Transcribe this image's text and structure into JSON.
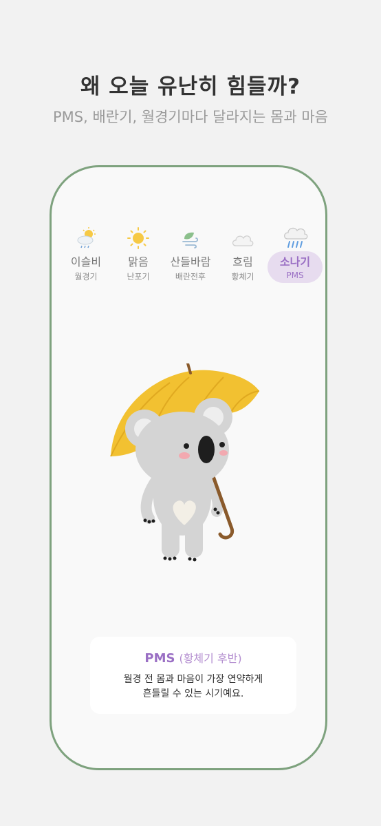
{
  "header": {
    "headline": "왜 오늘 유난히 힘들까?",
    "subheadline": "PMS, 배란기, 월경기마다 달라지는 몸과 마음"
  },
  "weather_tabs": [
    {
      "icon": "sun-rain-cloud-icon",
      "label": "이슬비",
      "sub": "월경기",
      "active": false
    },
    {
      "icon": "sun-icon",
      "label": "맑음",
      "sub": "난포기",
      "active": false
    },
    {
      "icon": "leaf-wind-icon",
      "label": "산들바람",
      "sub": "배란전후",
      "active": false
    },
    {
      "icon": "cloud-icon",
      "label": "흐림",
      "sub": "황체기",
      "active": false
    },
    {
      "icon": "rain-cloud-icon",
      "label": "소나기",
      "sub": "PMS",
      "active": true
    }
  ],
  "info_card": {
    "phase": "PMS",
    "sub": "(황체기 후반)",
    "desc_line1": "월경 전 몸과 마음이 가장 연약하게",
    "desc_line2": "흔들릴 수 있는 시기예요."
  },
  "colors": {
    "accent": "#9a6fc4",
    "frame": "#7ea27e",
    "umbrella": "#f2c131"
  }
}
